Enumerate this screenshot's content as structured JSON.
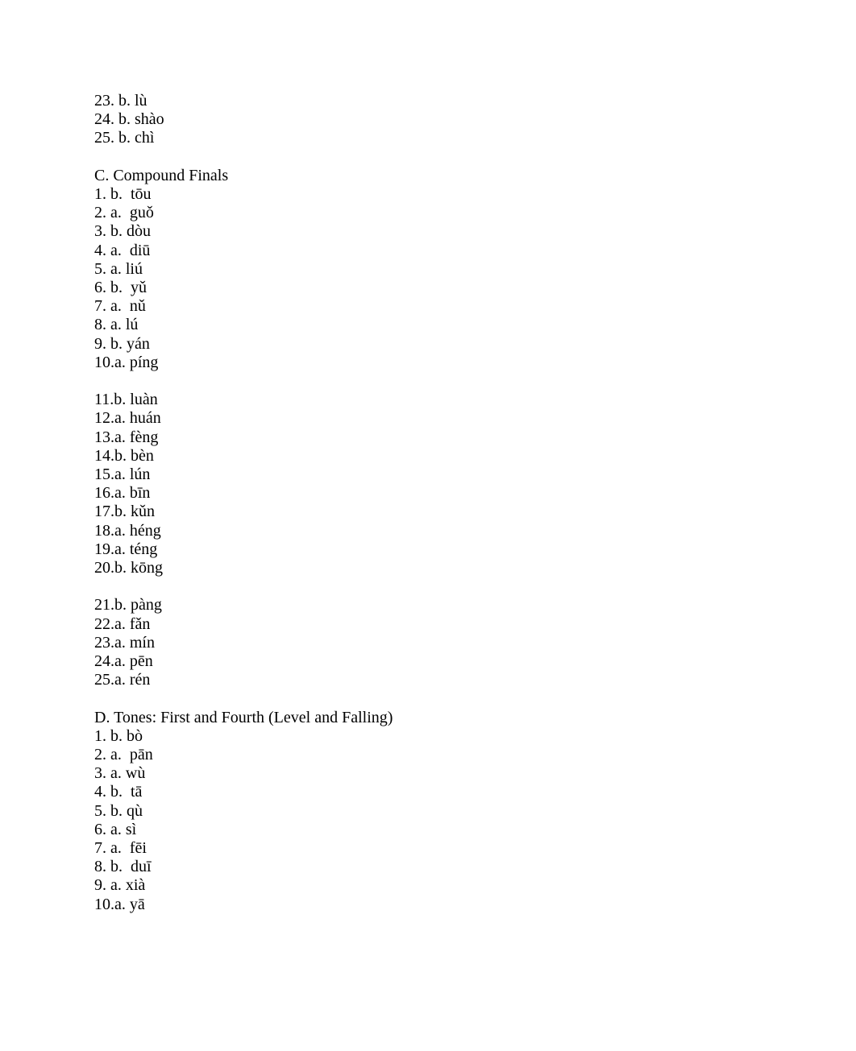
{
  "sections": [
    {
      "heading": null,
      "groups": [
        [
          {
            "num": "23.",
            "choice": "b.",
            "pinyin": "lù"
          },
          {
            "num": "24.",
            "choice": "b.",
            "pinyin": "shào"
          },
          {
            "num": "25.",
            "choice": "b.",
            "pinyin": "chì"
          }
        ]
      ]
    },
    {
      "heading": "C. Compound Finals",
      "groups": [
        [
          {
            "num": "1.",
            "choice": "b.",
            "pad": " ",
            "pinyin": "tōu"
          },
          {
            "num": "2.",
            "choice": "a.",
            "pad": " ",
            "pinyin": "guǒ"
          },
          {
            "num": "3.",
            "choice": "b.",
            "pinyin": "dòu"
          },
          {
            "num": "4.",
            "choice": "a.",
            "pad": " ",
            "pinyin": "diū"
          },
          {
            "num": "5.",
            "choice": "a.",
            "pinyin": "liú"
          },
          {
            "num": "6.",
            "choice": "b.",
            "pad": " ",
            "pinyin": "yǔ"
          },
          {
            "num": "7.",
            "choice": "a.",
            "pad": " ",
            "pinyin": "nǔ"
          },
          {
            "num": "8.",
            "choice": "a.",
            "pinyin": "lú"
          },
          {
            "num": "9.",
            "choice": "b.",
            "pinyin": "yán"
          },
          {
            "num": "10.",
            "choice": "a.",
            "nospace": true,
            "pinyin": "píng"
          }
        ],
        [
          {
            "num": "11.",
            "choice": "b.",
            "nospace": true,
            "pinyin": "luàn"
          },
          {
            "num": "12.",
            "choice": "a.",
            "nospace": true,
            "pinyin": "huán"
          },
          {
            "num": "13.",
            "choice": "a.",
            "nospace": true,
            "pinyin": "fèng"
          },
          {
            "num": "14.",
            "choice": "b.",
            "nospace": true,
            "pinyin": "bèn"
          },
          {
            "num": "15.",
            "choice": "a.",
            "nospace": true,
            "pinyin": "lún"
          },
          {
            "num": "16.",
            "choice": "a.",
            "nospace": true,
            "pinyin": "bīn"
          },
          {
            "num": "17.",
            "choice": "b.",
            "nospace": true,
            "pinyin": "kǔn"
          },
          {
            "num": "18.",
            "choice": "a.",
            "nospace": true,
            "pinyin": "héng"
          },
          {
            "num": "19.",
            "choice": "a.",
            "nospace": true,
            "pinyin": "téng"
          },
          {
            "num": "20.",
            "choice": "b.",
            "nospace": true,
            "pinyin": "kōng"
          }
        ],
        [
          {
            "num": "21.",
            "choice": "b.",
            "nospace": true,
            "pinyin": "pàng"
          },
          {
            "num": "22.",
            "choice": "a.",
            "nospace": true,
            "pinyin": "fǎn"
          },
          {
            "num": "23.",
            "choice": "a.",
            "nospace": true,
            "pinyin": "mín"
          },
          {
            "num": "24.",
            "choice": "a.",
            "nospace": true,
            "pinyin": "pēn"
          },
          {
            "num": "25.",
            "choice": "a.",
            "nospace": true,
            "pinyin": "rén"
          }
        ]
      ]
    },
    {
      "heading": "D. Tones: First and Fourth (Level and Falling)",
      "groups": [
        [
          {
            "num": "1.",
            "choice": "b.",
            "pinyin": "bò"
          },
          {
            "num": "2.",
            "choice": "a.",
            "pad": " ",
            "pinyin": "pān"
          },
          {
            "num": "3.",
            "choice": "a.",
            "pinyin": "wù"
          },
          {
            "num": "4.",
            "choice": "b.",
            "pad": " ",
            "pinyin": "tā"
          },
          {
            "num": "5.",
            "choice": "b.",
            "pinyin": "qù"
          },
          {
            "num": "6.",
            "choice": "a.",
            "pinyin": "sì"
          },
          {
            "num": "7.",
            "choice": "a.",
            "pad": " ",
            "pinyin": "fēi"
          },
          {
            "num": "8.",
            "choice": "b.",
            "pad": " ",
            "pinyin": "duī"
          },
          {
            "num": "9.",
            "choice": "a.",
            "pinyin": "xià"
          },
          {
            "num": "10.",
            "choice": "a.",
            "nospace": true,
            "pinyin": "yā"
          }
        ]
      ]
    }
  ]
}
